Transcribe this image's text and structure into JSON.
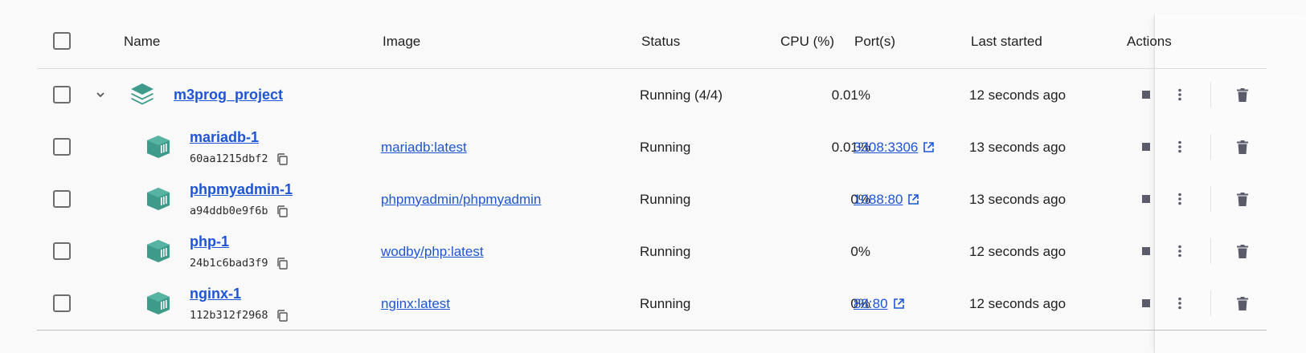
{
  "header": {
    "name": "Name",
    "image": "Image",
    "status": "Status",
    "cpu": "CPU (%)",
    "ports": "Port(s)",
    "last_started": "Last started",
    "actions": "Actions"
  },
  "project": {
    "name": "m3prog_project",
    "status": "Running (4/4)",
    "cpu": "0.01%",
    "last_started": "12 seconds ago",
    "icon": "stack-layers-icon"
  },
  "containers": [
    {
      "name": "mariadb-1",
      "id": "60aa1215dbf2",
      "image": "mariadb:latest",
      "status": "Running",
      "cpu": "0.01%",
      "port": "3308:3306",
      "last_started": "13 seconds ago"
    },
    {
      "name": "phpmyadmin-1",
      "id": "a94ddb0e9f6b",
      "image": "phpmyadmin/phpmyadmin",
      "status": "Running",
      "cpu": "0%",
      "port": "1088:80",
      "last_started": "13 seconds ago"
    },
    {
      "name": "php-1",
      "id": "24b1c6bad3f9",
      "image": "wodby/php:latest",
      "status": "Running",
      "cpu": "0%",
      "port": "",
      "last_started": "12 seconds ago"
    },
    {
      "name": "nginx-1",
      "id": "112b312f2968",
      "image": "nginx:latest",
      "status": "Running",
      "cpu": "0%",
      "port": "88:80",
      "last_started": "12 seconds ago"
    }
  ],
  "colors": {
    "accent_teal": "#3e9b8a",
    "link_blue": "#1e55d6",
    "icon_gray": "#5b5b6b"
  }
}
